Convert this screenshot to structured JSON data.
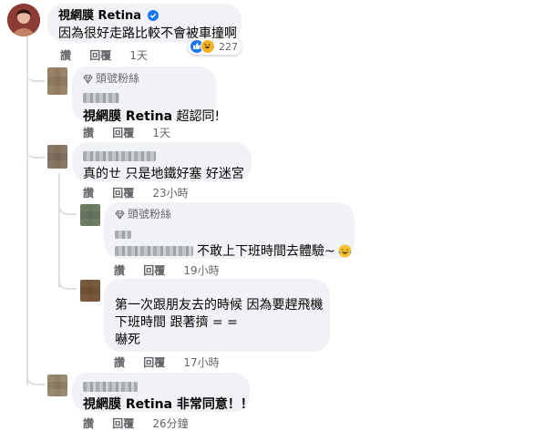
{
  "comments": [
    {
      "author": "視網膜 Retina",
      "verified": true,
      "text": "因為很好走路比較不會被車撞啊",
      "reaction_count": "227",
      "actions": {
        "like": "讚",
        "reply": "回覆",
        "time": "1天"
      }
    },
    {
      "badge": "頭號粉絲",
      "text_prefix": "視網膜 Retina",
      "text_suffix": " 超認同!",
      "actions": {
        "like": "讚",
        "reply": "回覆",
        "time": "1天"
      }
    },
    {
      "text": "真的ㄝ 只是地鐵好塞 好迷宮",
      "actions": {
        "like": "讚",
        "reply": "回覆",
        "time": "23小時"
      }
    },
    {
      "badge": "頭號粉絲",
      "text": "不敢上下班時間去體驗~",
      "actions": {
        "like": "讚",
        "reply": "回覆",
        "time": "19小時"
      }
    },
    {
      "lines": [
        "第一次跟朋友去的時候 因為要趕飛機",
        "下班時間 跟著擠 = =",
        "嚇死"
      ],
      "actions": {
        "like": "讚",
        "reply": "回覆",
        "time": "17小時"
      }
    },
    {
      "text": "視網膜 Retina 非常同意！！",
      "actions": {
        "like": "讚",
        "reply": "回覆",
        "time": "26分鐘"
      }
    }
  ],
  "colors": {
    "bubble": "#f0f2f5",
    "verified": "#1877f2",
    "meta_text": "#65676b"
  },
  "icons": [
    "verified-badge-icon",
    "diamond-icon",
    "like-reaction-icon",
    "haha-reaction-icon",
    "laughing-emoji-icon"
  ]
}
